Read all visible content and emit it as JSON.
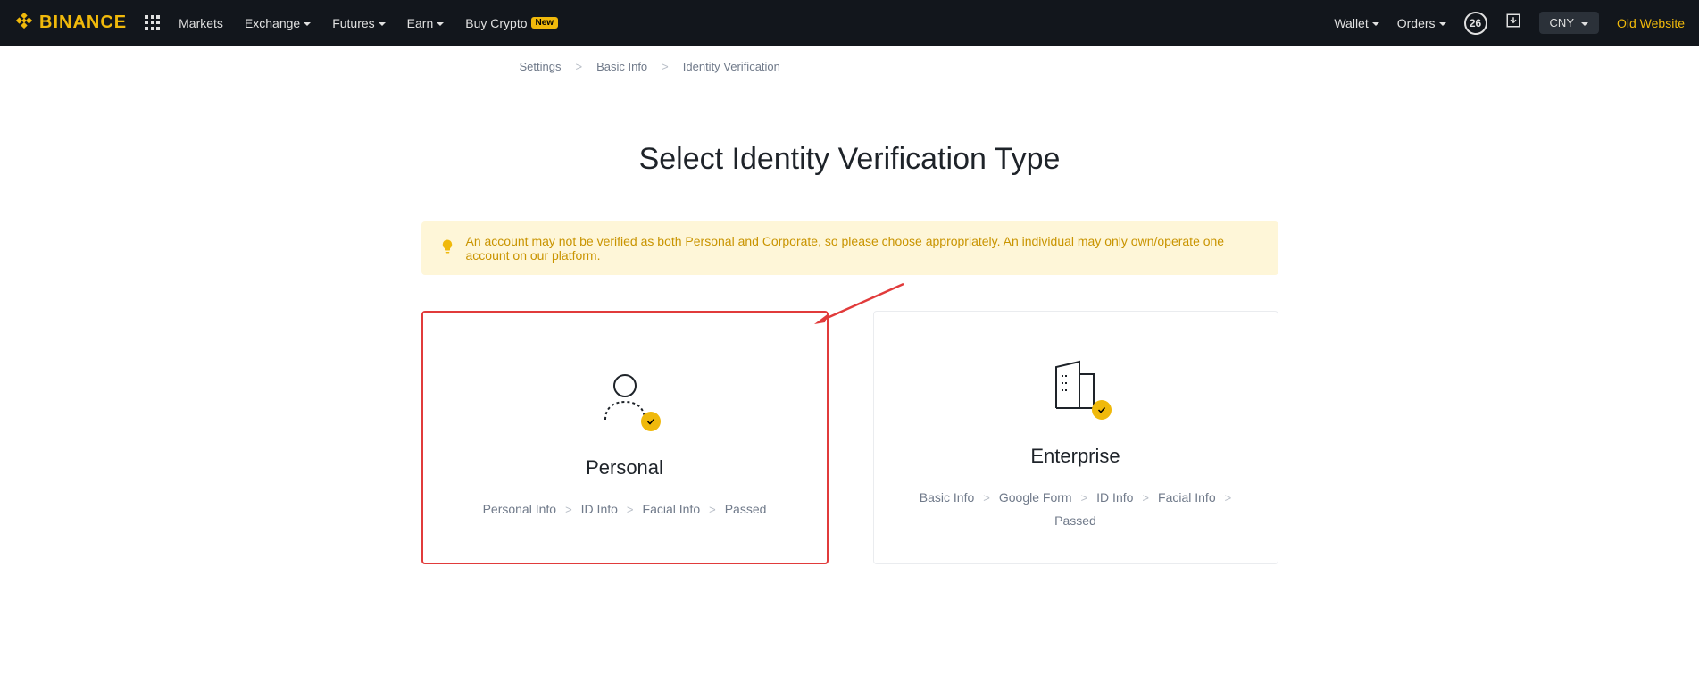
{
  "brand": "BINANCE",
  "nav": {
    "items": [
      {
        "label": "Markets",
        "hasDropdown": false
      },
      {
        "label": "Exchange",
        "hasDropdown": true
      },
      {
        "label": "Futures",
        "hasDropdown": true
      },
      {
        "label": "Earn",
        "hasDropdown": true
      },
      {
        "label": "Buy Crypto",
        "hasDropdown": false,
        "badge": "New"
      }
    ]
  },
  "header_right": {
    "wallet": "Wallet",
    "orders": "Orders",
    "notification_count": "26",
    "currency": "CNY",
    "old_website": "Old Website"
  },
  "breadcrumb": {
    "items": [
      "Settings",
      "Basic Info",
      "Identity Verification"
    ]
  },
  "page_title": "Select Identity Verification Type",
  "info_banner": "An account may not be verified as both Personal and Corporate, so please choose appropriately. An individual may only own/operate one account on our platform.",
  "cards": {
    "personal": {
      "title": "Personal",
      "steps": [
        "Personal Info",
        "ID Info",
        "Facial Info",
        "Passed"
      ]
    },
    "enterprise": {
      "title": "Enterprise",
      "steps": [
        "Basic Info",
        "Google Form",
        "ID Info",
        "Facial Info",
        "Passed"
      ]
    }
  }
}
